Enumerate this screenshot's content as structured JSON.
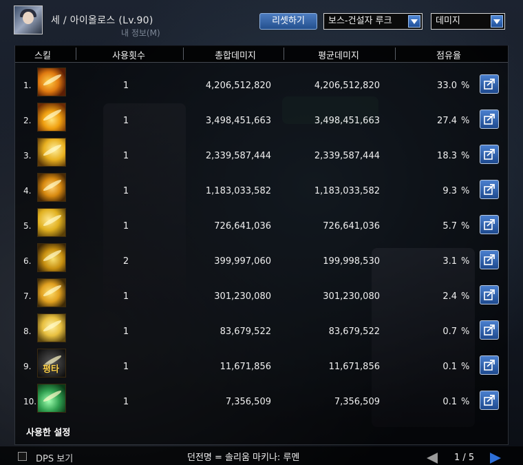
{
  "header": {
    "character": "세 / 아이올로스 (Lv.90)",
    "subtitle": "내 정보(M)",
    "reset_label": "리셋하기",
    "boss_select": "보스-건설자 루크",
    "type_select": "데미지"
  },
  "columns": [
    "스킬",
    "사용횟수",
    "총합데미지",
    "평균데미지",
    "점유율"
  ],
  "rows": [
    {
      "rank": "1.",
      "label": "",
      "uses": "1",
      "total": "4,206,512,820",
      "avg": "4,206,512,820",
      "share": "33.0",
      "pct": "%"
    },
    {
      "rank": "2.",
      "label": "",
      "uses": "1",
      "total": "3,498,451,663",
      "avg": "3,498,451,663",
      "share": "27.4",
      "pct": "%"
    },
    {
      "rank": "3.",
      "label": "",
      "uses": "1",
      "total": "2,339,587,444",
      "avg": "2,339,587,444",
      "share": "18.3",
      "pct": "%"
    },
    {
      "rank": "4.",
      "label": "",
      "uses": "1",
      "total": "1,183,033,582",
      "avg": "1,183,033,582",
      "share": "9.3",
      "pct": "%"
    },
    {
      "rank": "5.",
      "label": "",
      "uses": "1",
      "total": "726,641,036",
      "avg": "726,641,036",
      "share": "5.7",
      "pct": "%"
    },
    {
      "rank": "6.",
      "label": "",
      "uses": "2",
      "total": "399,997,060",
      "avg": "199,998,530",
      "share": "3.1",
      "pct": "%"
    },
    {
      "rank": "7.",
      "label": "",
      "uses": "1",
      "total": "301,230,080",
      "avg": "301,230,080",
      "share": "2.4",
      "pct": "%"
    },
    {
      "rank": "8.",
      "label": "",
      "uses": "1",
      "total": "83,679,522",
      "avg": "83,679,522",
      "share": "0.7",
      "pct": "%"
    },
    {
      "rank": "9.",
      "label": "평타",
      "uses": "1",
      "total": "11,671,856",
      "avg": "11,671,856",
      "share": "0.1",
      "pct": "%"
    },
    {
      "rank": "10.",
      "label": "",
      "uses": "1",
      "total": "7,356,509",
      "avg": "7,356,509",
      "share": "0.1",
      "pct": "%"
    }
  ],
  "icons": [
    "skill-icon-1",
    "skill-icon-2",
    "skill-icon-3",
    "skill-icon-4",
    "skill-icon-5",
    "skill-icon-6",
    "skill-icon-7",
    "skill-icon-8",
    "skill-icon-9",
    "skill-icon-10"
  ],
  "footer": {
    "used_settings": "사용한 설정",
    "dps_label": "DPS 보기",
    "dungeon": "던전명 = 솔리움 마키나: 루멘",
    "page": "1 / 5"
  },
  "colors": {
    "accent": "#2e6fd8",
    "skill_label": "#ffd24a",
    "button_blue": "#23508e"
  }
}
